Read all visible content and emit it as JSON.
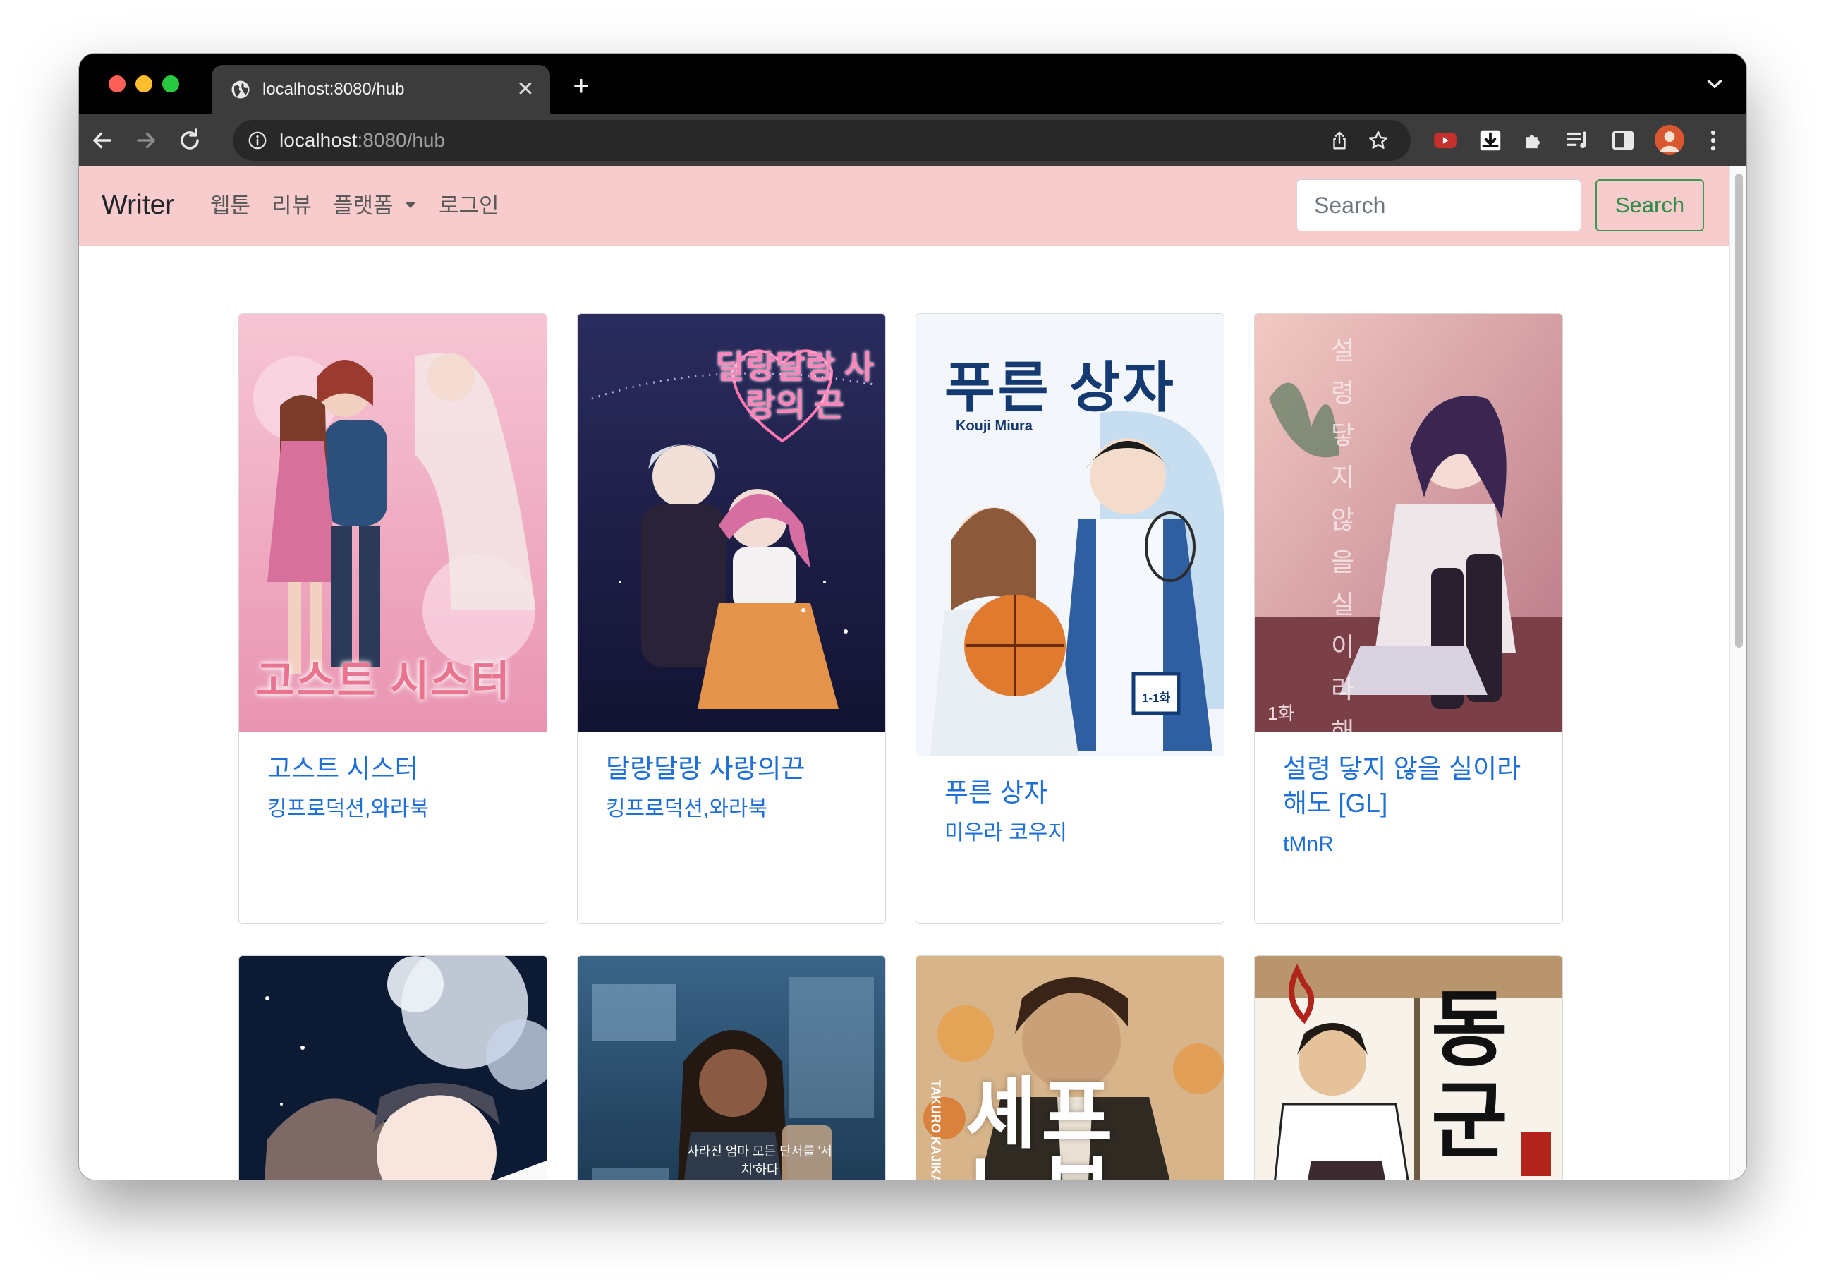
{
  "browser": {
    "tab_title": "localhost:8080/hub",
    "url_host": "localhost",
    "url_path": ":8080/hub",
    "new_tab": "+",
    "close": "✕"
  },
  "navbar": {
    "brand": "Writer",
    "links": [
      "웹툰",
      "리뷰",
      "플랫폼",
      "로그인"
    ],
    "search_placeholder": "Search",
    "search_button": "Search"
  },
  "cards": [
    {
      "title": "고스트 시스터",
      "author": "킹프로덕션,와라북",
      "cover_text": "고스트 시스터",
      "palette": [
        "#f4b4c8",
        "#e998b6",
        "#fbe0e8"
      ]
    },
    {
      "title": "달랑달랑 사랑의끈",
      "author": "킹프로덕션,와라북",
      "cover_text": "달랑달랑 사랑의 끈",
      "palette": [
        "#1b1d45",
        "#2b2f63",
        "#e96fa4"
      ]
    },
    {
      "title": "푸른 상자",
      "author": "미우라 코우지",
      "cover_text": "푸른 상자",
      "cover_subtitle": "Kouji Miura",
      "cover_badge": "1-1화",
      "palette": [
        "#f4f7fb",
        "#a9c8e6",
        "#1a3a6a"
      ]
    },
    {
      "title": "설령 닿지 않을 실이라 해도 [GL]",
      "author": "tMnR",
      "cover_text": "설령 닿지 않을 실이라 해도",
      "cover_badge": "1화",
      "palette": [
        "#e9b9b9",
        "#b0707b",
        "#5b3b4d"
      ]
    },
    {
      "title": "",
      "author": "",
      "palette": [
        "#0d1a33",
        "#c9d3e6",
        "#f4e6ea"
      ]
    },
    {
      "title": "",
      "author": "",
      "cover_text": "사라진 엄마 모든 단서를 '서치'하다",
      "palette": [
        "#1a3650",
        "#4d7aa0",
        "#9fbfd8"
      ]
    },
    {
      "title": "",
      "author": "",
      "cover_text": "셰프 노부",
      "cover_subtitle": "TAKURO KAJIKAWA",
      "palette": [
        "#d8b48a",
        "#a4623b",
        "#3a2418"
      ]
    },
    {
      "title": "",
      "author": "",
      "cover_text": "동군",
      "palette": [
        "#f5f0e6",
        "#b8956c",
        "#1b1b1b"
      ]
    }
  ]
}
